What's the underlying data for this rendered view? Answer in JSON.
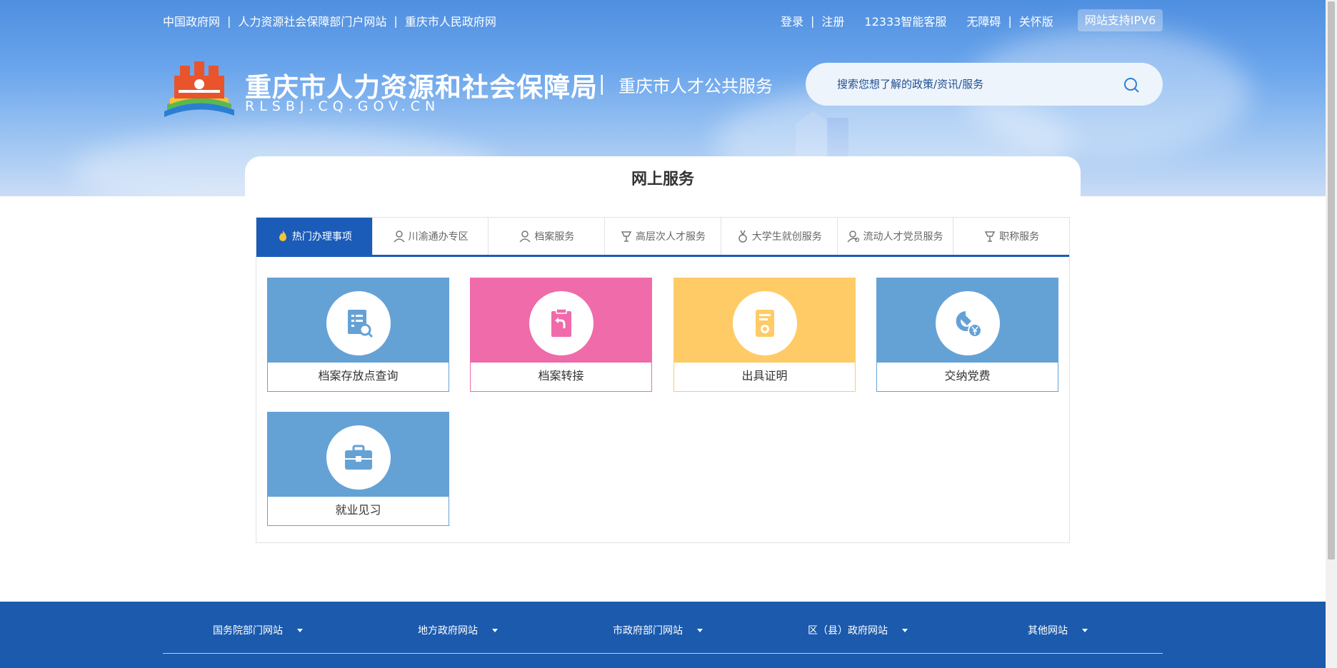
{
  "topbar": {
    "links": [
      "中国政府网",
      "人力资源社会保障部门户网站",
      "重庆市人民政府网"
    ],
    "login": "登录",
    "register": "注册",
    "service_hotline": "12333智能客服",
    "accessibility": "无障碍",
    "care_mode": "关怀版",
    "ipv6": "网站支持IPV6"
  },
  "header": {
    "title": "重庆市人力资源和社会保障局",
    "domain": "RLSBJ.CQ.GOV.CN",
    "separator": "|",
    "service_title": "重庆市人才公共服务"
  },
  "search": {
    "placeholder": "搜索您想了解的政策/资讯/服务",
    "value": ""
  },
  "main": {
    "section_title": "网上服务",
    "tabs": [
      {
        "label": "热门办理事项",
        "icon": "flame-icon",
        "active": true
      },
      {
        "label": "川渝通办专区",
        "icon": "person-icon",
        "active": false
      },
      {
        "label": "档案服务",
        "icon": "person-icon",
        "active": false
      },
      {
        "label": "高层次人才服务",
        "icon": "award-icon",
        "active": false
      },
      {
        "label": "大学生就创服务",
        "icon": "medal-icon",
        "active": false
      },
      {
        "label": "流动人才党员服务",
        "icon": "person-gear-icon",
        "active": false
      },
      {
        "label": "职称服务",
        "icon": "award-icon",
        "active": false
      }
    ],
    "tiles": [
      {
        "label": "档案存放点查询",
        "icon": "document-search-icon",
        "color": "#64a2d6"
      },
      {
        "label": "档案转接",
        "icon": "clipboard-return-icon",
        "color": "#ef6ba9"
      },
      {
        "label": "出具证明",
        "icon": "certificate-icon",
        "color": "#ffcb66"
      },
      {
        "label": "交纳党费",
        "icon": "party-fee-icon",
        "color": "#64a2d6"
      },
      {
        "label": "就业见习",
        "icon": "briefcase-icon",
        "color": "#64a2d6"
      }
    ]
  },
  "footer": {
    "links": [
      "国务院部门网站",
      "地方政府网站",
      "市政府部门网站",
      "区（县）政府网站",
      "其他网站"
    ]
  },
  "colors": {
    "primary": "#1a5cb8",
    "footer": "#1b5aad",
    "blue_tile": "#64a2d6",
    "pink_tile": "#ef6ba9",
    "yellow_tile": "#ffcb66"
  }
}
